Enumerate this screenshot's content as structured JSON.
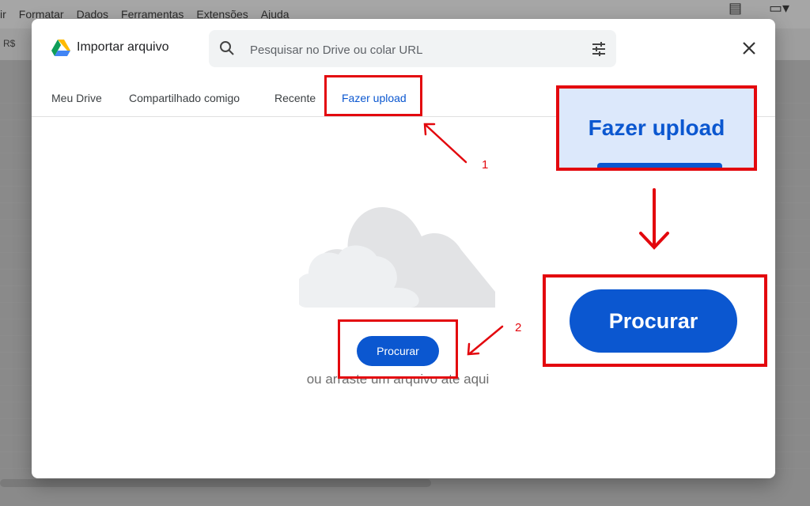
{
  "background_app": {
    "menu": [
      "ir",
      "Formatar",
      "Dados",
      "Ferramentas",
      "Extensões",
      "Ajuda"
    ],
    "toolbar_partial": "R$"
  },
  "dialog": {
    "title": "Importar arquivo",
    "search": {
      "placeholder": "Pesquisar no Drive ou colar URL"
    },
    "tabs": [
      {
        "label": "Meu Drive",
        "active": false
      },
      {
        "label": "Compartilhado comigo",
        "active": false
      },
      {
        "label": "Recente",
        "active": false
      },
      {
        "label": "Fazer upload",
        "active": true
      }
    ],
    "upload": {
      "browse_label": "Procurar",
      "drag_text": "ou arraste um arquivo até aqui"
    }
  },
  "annotations": {
    "step1_number": "1",
    "step2_number": "2",
    "zoom_tab_label": "Fazer upload",
    "zoom_button_label": "Procurar"
  },
  "colors": {
    "accent": "#0b57d0",
    "annotation_red": "#e3080e",
    "zoom_tab_bg": "#dce8fb"
  }
}
